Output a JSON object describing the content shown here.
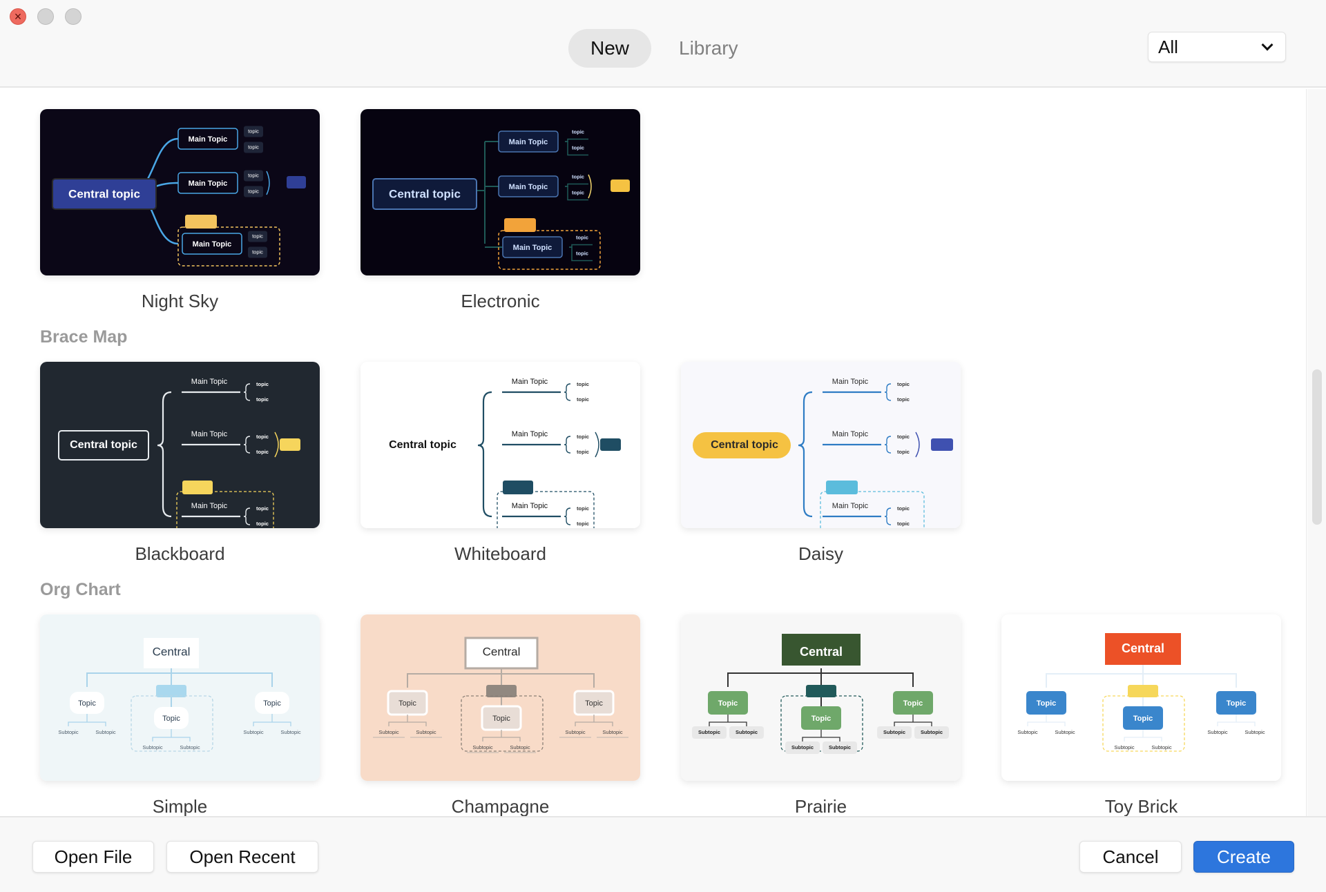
{
  "window": {
    "controls": [
      "close",
      "minimize",
      "zoom"
    ]
  },
  "header": {
    "tabs": [
      {
        "label": "New",
        "active": true
      },
      {
        "label": "Library",
        "active": false
      }
    ],
    "filter": {
      "selected": "All"
    }
  },
  "sections": [
    {
      "title": "",
      "templates": [
        {
          "name": "Night Sky",
          "central": "Central topic",
          "main": "Main Topic",
          "sub": "topic"
        },
        {
          "name": "Electronic",
          "central": "Central topic",
          "main": "Main Topic",
          "sub": "topic"
        }
      ]
    },
    {
      "title": "Brace Map",
      "templates": [
        {
          "name": "Blackboard",
          "central": "Central topic",
          "main": "Main Topic",
          "sub": "topic"
        },
        {
          "name": "Whiteboard",
          "central": "Central topic",
          "main": "Main Topic",
          "sub": "topic"
        },
        {
          "name": "Daisy",
          "central": "Central topic",
          "main": "Main Topic",
          "sub": "topic"
        }
      ]
    },
    {
      "title": "Org Chart",
      "templates": [
        {
          "name": "Simple",
          "central": "Central",
          "main": "Topic",
          "sub": "Subtopic"
        },
        {
          "name": "Champagne",
          "central": "Central",
          "main": "Topic",
          "sub": "Subtopic"
        },
        {
          "name": "Prairie",
          "central": "Central",
          "main": "Topic",
          "sub": "Subtopic"
        },
        {
          "name": "Toy Brick",
          "central": "Central",
          "main": "Topic",
          "sub": "Subtopic"
        }
      ]
    }
  ],
  "themes": {
    "Night Sky": {
      "bg": "#0b0717",
      "line": "#4aa7e6",
      "central_fill": "#2f3f96",
      "central_text": "#ffffff",
      "main_stroke": "#4aa7e6",
      "main_text": "#ffffff",
      "sub_fill": "#1f2538",
      "sub_text": "#ffffff",
      "accent": "#f2c35e",
      "summary": "#2f3f96"
    },
    "Electronic": {
      "bg": "#060310",
      "line": "#1f5a57",
      "central_fill": "#0f1a3a",
      "central_text": "#cfe0ff",
      "main_stroke": "#4a74b0",
      "main_text": "#cfe0ff",
      "sub_text": "#cfe0ff",
      "accent": "#f2a33a",
      "summary": "#f5c242",
      "brace": "#f5d76e"
    },
    "Blackboard": {
      "bg": "#212830",
      "line": "#e8ecef",
      "central_text": "#ffffff",
      "main_text": "#ffffff",
      "sub_text": "#ffffff",
      "accent": "#f6d55c",
      "summary": "#f6d55c"
    },
    "Whiteboard": {
      "bg": "#ffffff",
      "line": "#1f4d63",
      "central_text": "#111111",
      "main_text": "#111111",
      "sub_text": "#333333",
      "accent": "#1f4d63",
      "summary": "#1f4d63"
    },
    "Daisy": {
      "bg": "#f8f8fc",
      "line": "#2e7cc4",
      "central_fill": "#f5c242",
      "central_text": "#2a2a2a",
      "main_text": "#2a2a2a",
      "sub_text": "#333333",
      "accent": "#5bbcdc",
      "summary": "#3f51b0"
    },
    "Simple": {
      "bg": "#eff6f8",
      "line": "#a9d3ea",
      "central_fill": "#ffffff",
      "central_text": "#2c3e50",
      "topic_fill": "#ffffff",
      "topic_text": "#2c3e50",
      "sub_text": "#4a5a68",
      "accent": "#a9d8ee"
    },
    "Champagne": {
      "bg": "#f8dbc8",
      "line": "#b5aba3",
      "central_fill": "#ffffff",
      "central_text": "#2a2a2a",
      "topic_fill": "#e8ddd6",
      "topic_text": "#333333",
      "sub_text": "#444444",
      "accent": "#918880"
    },
    "Prairie": {
      "bg": "#f7f7f7",
      "line": "#333333",
      "central_fill": "#385630",
      "central_text": "#ffffff",
      "topic_fill": "#6fa86a",
      "topic_text": "#ffffff",
      "sub_fill": "#e8e8e8",
      "sub_text": "#222222",
      "accent": "#215a5a"
    },
    "Toy Brick": {
      "bg": "#ffffff",
      "line": "#e3eef7",
      "central_fill": "#ec5127",
      "central_text": "#ffffff",
      "topic_fill": "#3a86cc",
      "topic_text": "#ffffff",
      "sub_text": "#333333",
      "accent": "#f6d75a"
    }
  },
  "footer": {
    "open_file": "Open File",
    "open_recent": "Open Recent",
    "cancel": "Cancel",
    "create": "Create"
  }
}
